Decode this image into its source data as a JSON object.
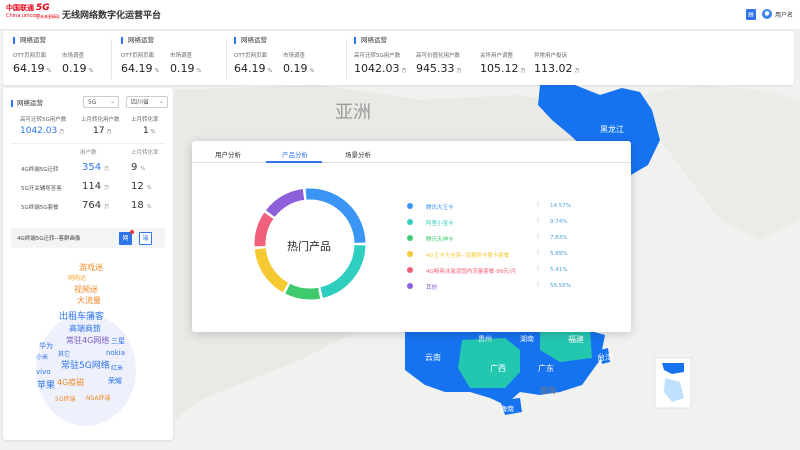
{
  "header": {
    "brand_cn": "中国联通",
    "brand_en": "China unicom",
    "g5_label": "5G",
    "g5_sub": "让未来更精彩",
    "title": "无线网络数字化运营平台",
    "doc_icon": "document-icon",
    "user_icon": "user-icon",
    "user_name": "用户名"
  },
  "top_groups": [
    {
      "title": "网络运营",
      "items": [
        {
          "label": "OTT页网页面",
          "value": "64.19",
          "unit": "%"
        },
        {
          "label": "市场调查",
          "value": "0.19",
          "unit": "%"
        }
      ]
    },
    {
      "title": "网络运营",
      "items": [
        {
          "label": "OTT页网页面",
          "value": "64.19",
          "unit": "%"
        },
        {
          "label": "市场调查",
          "value": "0.19",
          "unit": "%"
        }
      ]
    },
    {
      "title": "网络运营",
      "items": [
        {
          "label": "OTT页网页面",
          "value": "64.19",
          "unit": "%"
        },
        {
          "label": "市场调查",
          "value": "0.19",
          "unit": "%"
        }
      ]
    },
    {
      "title": "网络运营",
      "items": [
        {
          "label": "高可迁转5G用户数",
          "value": "1042.03",
          "unit": "万"
        },
        {
          "label": "高可价值化用户数",
          "value": "945.33",
          "unit": "万"
        },
        {
          "label": "关怀用户调整",
          "value": "105.12",
          "unit": "万"
        },
        {
          "label": "异常用户投诉",
          "value": "113.02",
          "unit": "万"
        }
      ]
    }
  ],
  "left_panel": {
    "title": "网络运营",
    "select_network": "5G",
    "select_region": "四川省",
    "kpis": [
      {
        "label": "高可迁转5G用户数",
        "value": "1042.03",
        "unit": "万"
      },
      {
        "label": "上月转化用户数",
        "value": "17",
        "unit": "万"
      },
      {
        "label": "上月转化率",
        "value": "1",
        "unit": "%"
      }
    ],
    "col_headers": [
      "用户数",
      "上月转化率"
    ],
    "rows": [
      {
        "label": "4G终端5G迁转",
        "v1": "354",
        "u1": "万",
        "v2": "9",
        "u2": "%"
      },
      {
        "label": "5G开关辅导答客",
        "v1": "114",
        "u1": "万",
        "v2": "12",
        "u2": "%"
      },
      {
        "label": "5G终端5G套餐",
        "v1": "764",
        "u1": "万",
        "v2": "18",
        "u2": "%"
      }
    ],
    "input_text": "4G终端5G迁转--客群画像",
    "btn_net": "网",
    "btn_end": "端",
    "word_cloud": [
      {
        "text": "游戏迷",
        "color": "#f08a2c"
      },
      {
        "text": "网购达",
        "color": "#f5a623"
      },
      {
        "text": "视频迷",
        "color": "#f08a2c"
      },
      {
        "text": "大流量",
        "color": "#f08a2c"
      },
      {
        "text": "出租车蒲客",
        "color": "#2f74e8"
      },
      {
        "text": "高端商旅",
        "color": "#2f74e8"
      },
      {
        "text": "常驻4G网络",
        "color": "#7a5cc8"
      },
      {
        "text": "华为",
        "color": "#2f74e8"
      },
      {
        "text": "三星",
        "color": "#2f74e8"
      },
      {
        "text": "nokia",
        "color": "#2f74e8"
      },
      {
        "text": "小米",
        "color": "#2f74e8"
      },
      {
        "text": "其它",
        "color": "#2f74e8"
      },
      {
        "text": "常驻5G网络",
        "color": "#2f74e8"
      },
      {
        "text": "vivo",
        "color": "#2f74e8"
      },
      {
        "text": "红米",
        "color": "#2f74e8"
      },
      {
        "text": "苹果",
        "color": "#2f74e8"
      },
      {
        "text": "4G疫磁",
        "color": "#f08a2c"
      },
      {
        "text": "荣耀",
        "color": "#2f74e8"
      },
      {
        "text": "5G终端",
        "color": "#f08a2c"
      },
      {
        "text": "NSA终端",
        "color": "#f08a2c"
      }
    ]
  },
  "modal": {
    "tabs": [
      "用户分析",
      "产品分析",
      "场景分析"
    ],
    "active_tab": 1,
    "center_label": "热门产品"
  },
  "map_labels": {
    "asia": "亚洲",
    "heilongjiang": "黑龙江",
    "yunnan": "云南",
    "guangxi": "广西",
    "guangdong": "广东",
    "fujian": "福建",
    "taiwan": "台湾",
    "guizhou": "贵州",
    "hunan": "湖南",
    "hainan": "海南",
    "south_sea": "南海"
  },
  "colors": {
    "accent": "#2f74e8",
    "map_blue": "#1673f0",
    "map_teal": "#23c7b0"
  },
  "chart_data": {
    "type": "pie",
    "title": "热门产品",
    "series": [
      {
        "name": "腾讯大王卡",
        "value": 14.57,
        "pct": "14.57%",
        "color": "#3b95f5"
      },
      {
        "name": "阿里小宝卡",
        "value": 9.74,
        "pct": "9.74%",
        "color": "#2fcfc0"
      },
      {
        "name": "腾讯天神卡",
        "value": 7.83,
        "pct": "7.83%",
        "color": "#3fcb6d"
      },
      {
        "name": "4G王卡大全系--流量随卡第卡套餐",
        "value": 5.89,
        "pct": "5.89%",
        "color": "#f5c932"
      },
      {
        "name": "4G畅爽冰激凌国内流量套餐-99元/月",
        "value": 5.41,
        "pct": "5.41%",
        "color": "#f0607a"
      },
      {
        "name": "其他",
        "value": 56.56,
        "pct": "56.56%",
        "color": "#8e5fdb"
      }
    ]
  }
}
